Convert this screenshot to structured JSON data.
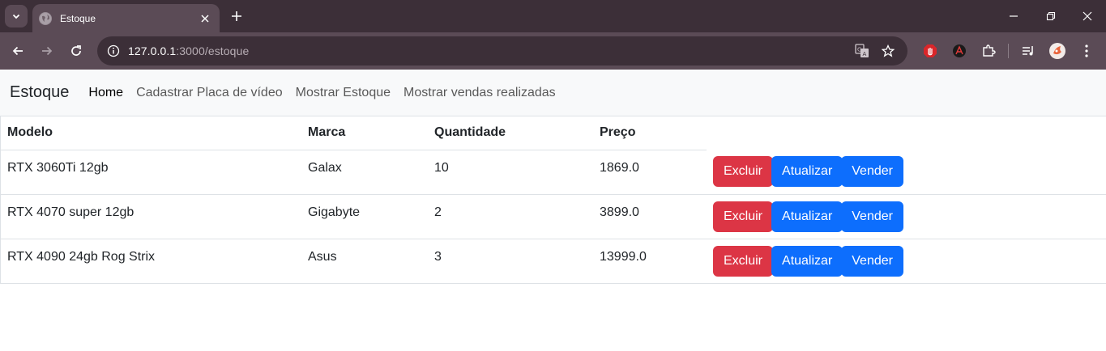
{
  "browser": {
    "tab_title": "Estoque",
    "url_host": "127.0.0.1",
    "url_rest": ":3000/estoque"
  },
  "nav": {
    "brand": "Estoque",
    "links": [
      "Home",
      "Cadastrar Placa de vídeo",
      "Mostrar Estoque",
      "Mostrar vendas realizadas"
    ],
    "active": "Home"
  },
  "table": {
    "headers": [
      "Modelo",
      "Marca",
      "Quantidade",
      "Preço"
    ],
    "rows": [
      [
        "RTX 3060Ti 12gb",
        "Galax",
        "10",
        "1869.0"
      ],
      [
        "RTX 4070 super 12gb",
        "Gigabyte",
        "2",
        "3899.0"
      ],
      [
        "RTX 4090 24gb Rog Strix",
        "Asus",
        "3",
        "13999.0"
      ]
    ],
    "actions": {
      "delete": "Excluir",
      "update": "Atualizar",
      "sell": "Vender"
    }
  },
  "colors": {
    "danger": "#dc3545",
    "primary": "#0d6efd",
    "chrome_dark": "#3c2f38",
    "chrome_mid": "#5b4b56"
  }
}
